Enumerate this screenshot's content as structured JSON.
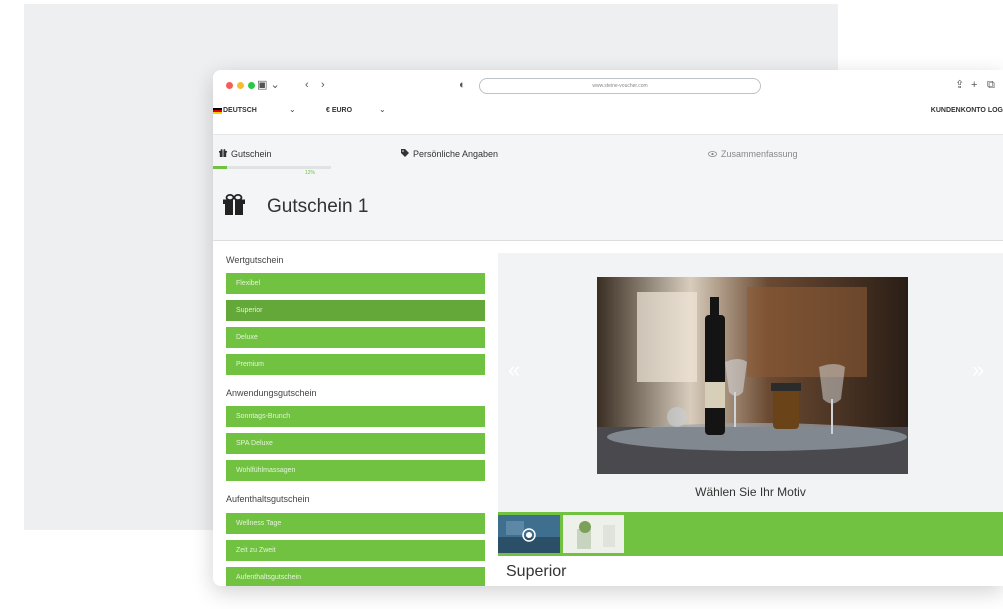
{
  "browser": {
    "url": "www.steine-voucher.com"
  },
  "topbar": {
    "language": "DEUTSCH",
    "currency": "€ EURO",
    "account": "KUNDENKONTO LOG"
  },
  "steps": [
    {
      "label": "Gutschein",
      "icon": "gift-icon"
    },
    {
      "label": "Persönliche Angaben",
      "icon": "tag-icon"
    },
    {
      "label": "Zusammenfassung",
      "icon": "eye-icon"
    }
  ],
  "progress": {
    "value": 0.12,
    "label": "12%"
  },
  "header": {
    "title": "Gutschein 1"
  },
  "sidebar": {
    "groups": [
      {
        "label": "Wertgutschein",
        "items": [
          "Flexibel",
          "Superior",
          "Deluxe",
          "Premium"
        ]
      },
      {
        "label": "Anwendungsgutschein",
        "items": [
          "Sonntags-Brunch",
          "SPA Deluxe",
          "Wohlfühlmassagen"
        ]
      },
      {
        "label": "Aufenthaltsgutschein",
        "items": [
          "Wellness Tage",
          "Zeit zu Zweit",
          "Aufenthaltsgutschein"
        ]
      }
    ],
    "active_item": "Superior"
  },
  "slider": {
    "prev": "«",
    "next": "»",
    "caption": "Wählen Sie Ihr Motiv"
  },
  "selected": {
    "title": "Superior"
  },
  "colors": {
    "accent": "#72c242",
    "accent_dark": "#64a83a"
  }
}
